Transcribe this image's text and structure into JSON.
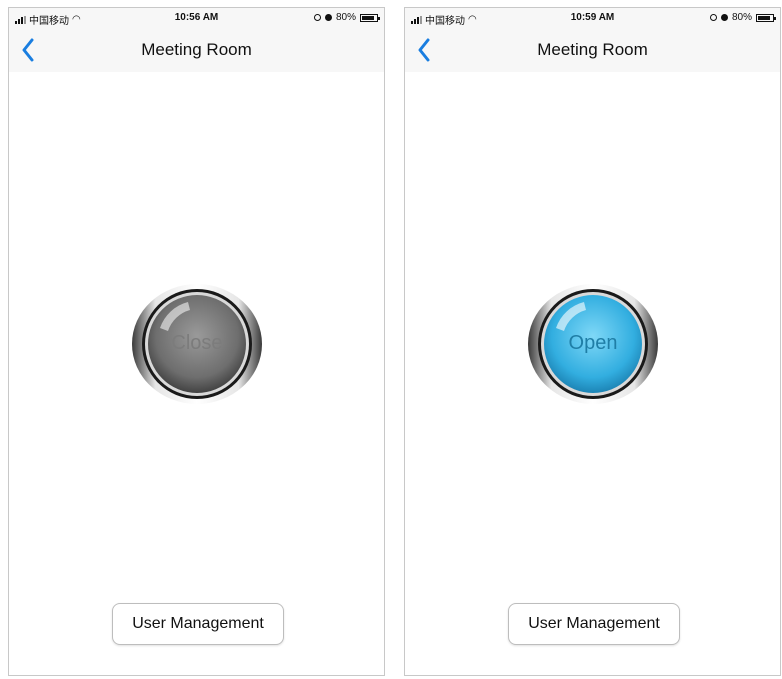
{
  "screens": [
    {
      "status": {
        "carrier": "中国移动",
        "time": "10:56 AM",
        "battery": "80%"
      },
      "nav": {
        "title": "Meeting Room"
      },
      "power_button": {
        "label": "Close",
        "state": "off"
      },
      "user_management_label": "User Management"
    },
    {
      "status": {
        "carrier": "中国移动",
        "time": "10:59 AM",
        "battery": "80%"
      },
      "nav": {
        "title": "Meeting Room"
      },
      "power_button": {
        "label": "Open",
        "state": "on"
      },
      "user_management_label": "User Management"
    }
  ],
  "colors": {
    "accent": "#1a7ee0",
    "button_off": "#8a8a8a",
    "button_on": "#3bb8e8"
  },
  "icons": {
    "back": "chevron-left-icon",
    "signal": "signal-icon",
    "wifi": "wifi-icon",
    "location": "location-icon",
    "alarm": "alarm-icon",
    "battery": "battery-icon"
  }
}
